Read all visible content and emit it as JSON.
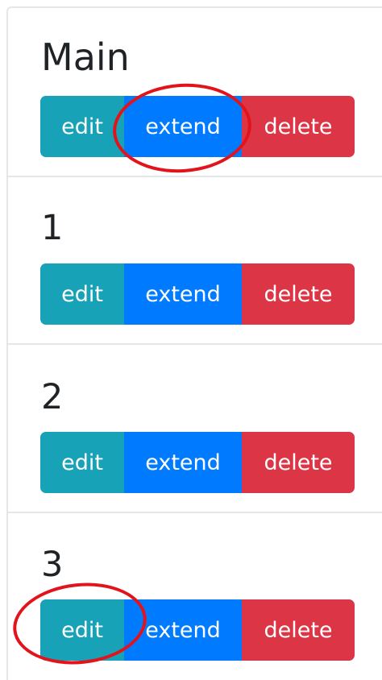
{
  "items": [
    {
      "title": "Main",
      "edit_label": "edit",
      "extend_label": "extend",
      "delete_label": "delete"
    },
    {
      "title": "1",
      "edit_label": "edit",
      "extend_label": "extend",
      "delete_label": "delete"
    },
    {
      "title": "2",
      "edit_label": "edit",
      "extend_label": "extend",
      "delete_label": "delete"
    },
    {
      "title": "3",
      "edit_label": "edit",
      "extend_label": "extend",
      "delete_label": "delete"
    }
  ],
  "colors": {
    "edit": "#17a2b8",
    "extend": "#007bff",
    "delete": "#dc3545",
    "annotation": "#e3131b",
    "divider": "#e4e6ea"
  }
}
